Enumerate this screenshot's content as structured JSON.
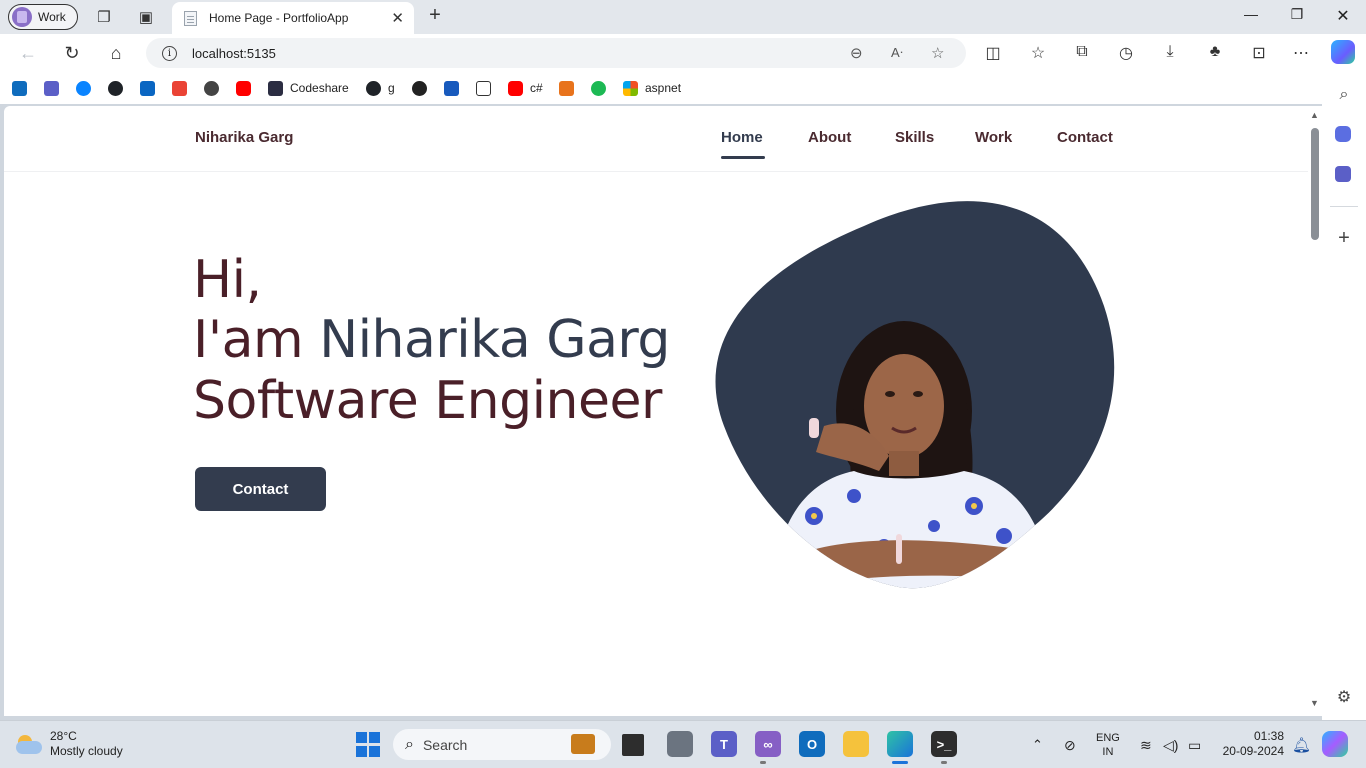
{
  "browser": {
    "profile_label": "Work",
    "tab_title": "Home Page - PortfolioApp",
    "url": "localhost:5135",
    "favorites": [
      {
        "label": "",
        "color": "#0f6cbd"
      },
      {
        "label": "",
        "color": "#5b5fc7"
      },
      {
        "label": "",
        "color": "#0a84ff"
      },
      {
        "label": "",
        "color": "#1f2328"
      },
      {
        "label": "",
        "color": "#0a66c2"
      },
      {
        "label": "",
        "color": "#ea4335"
      },
      {
        "label": "",
        "color": "#444444"
      },
      {
        "label": "",
        "color": "#ff0000"
      },
      {
        "label": "Codeshare",
        "color": "#2b2d42"
      },
      {
        "label": "g",
        "color": "#1f2328"
      },
      {
        "label": "",
        "color": "#222222"
      },
      {
        "label": "",
        "color": "#185abd"
      },
      {
        "label": "",
        "color": "#333333"
      },
      {
        "label": "c#",
        "color": "#ff0000"
      },
      {
        "label": "",
        "color": "#e8731c"
      },
      {
        "label": "",
        "color": "#1db954"
      },
      {
        "label": "aspnet",
        "color": "#f25022"
      }
    ]
  },
  "site": {
    "brand": "Niharika Garg",
    "nav": [
      "Home",
      "About",
      "Skills",
      "Work",
      "Contact"
    ],
    "active_nav": "Home",
    "hero": {
      "line1": "Hi,",
      "line2_prefix": "I'am ",
      "line2_name": "Niharika Garg",
      "line3": "Software Engineer"
    },
    "cta_label": "Contact",
    "colors": {
      "primary": "#333c4e",
      "text": "#4a1f28",
      "blob": "#2f3a4e"
    }
  },
  "taskbar": {
    "weather_temp": "28°C",
    "weather_desc": "Mostly cloudy",
    "search_placeholder": "Search",
    "lang_line1": "ENG",
    "lang_line2": "IN",
    "time": "01:38",
    "date": "20-09-2024"
  }
}
